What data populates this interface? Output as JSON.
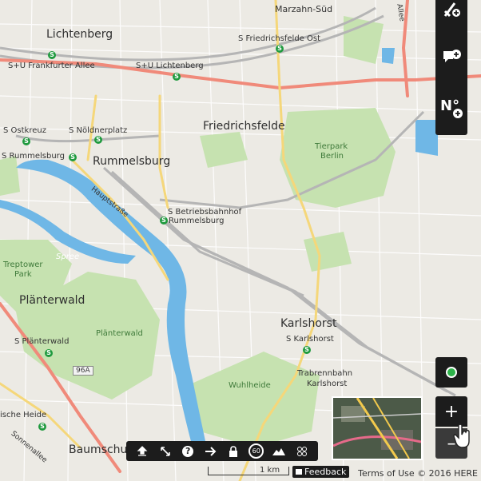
{
  "map": {
    "districts": {
      "lichtenberg": "Lichtenberg",
      "friedrichsfelde": "Friedrichsfelde",
      "rummelsburg": "Rummelsburg",
      "planterwald": "Plänterwald",
      "karlshorst": "Karlshorst",
      "baumschulenweg": "Baumschu",
      "marzahn_sued": "Marzahn-Süd"
    },
    "stations": {
      "frankfurter_allee": "S+U Frankfurter Allee",
      "lichtenberg": "S+U Lichtenberg",
      "friedrichsfelde_ost": "S Friedrichsfelde Ost",
      "ostkreuz": "S Ostkreuz",
      "noeldnerplatz": "S Nöldnerplatz",
      "rummelsburg": "S Rummelsburg",
      "betriebsbahnhof_1": "S Betriebsbahnhof",
      "betriebsbahnhof_2": "Rummelsburg",
      "planterwald": "S Plänterwald",
      "karlshorst": "S Karlshorst",
      "schoeneweide": "ische Heide"
    },
    "parks": {
      "tierpark_1": "Tierpark",
      "tierpark_2": "Berlin",
      "treptower_1": "Treptower",
      "treptower_2": "Park",
      "planterwald_forest": "Plänterwald",
      "wuhlheide": "Wuhlheide",
      "trabrennbahn_1": "Trabrennbahn",
      "trabrennbahn_2": "Karlshorst"
    },
    "water": {
      "spree": "Spree"
    },
    "streets": {
      "hauptstrasse": "Hauptstraße",
      "sonnenallee": "Sonnenallee",
      "allee": "Allee",
      "road_badge": "96A"
    }
  },
  "controls": {
    "top": [
      {
        "name": "add-route-icon"
      },
      {
        "name": "add-comment-icon"
      },
      {
        "name": "add-number-icon",
        "glyph": "N°"
      }
    ],
    "locate_icon": "location-dot-icon",
    "zoom_in": "+",
    "zoom_out": "–",
    "toolbar": [
      {
        "name": "upload-icon",
        "glyph": "⬆"
      },
      {
        "name": "measure-icon",
        "glyph": "⤡"
      },
      {
        "name": "help-icon",
        "glyph": "?"
      },
      {
        "name": "arrow-right-icon",
        "glyph": "→"
      },
      {
        "name": "lock-icon",
        "glyph": "🔒"
      },
      {
        "name": "speed-limit-icon",
        "glyph": "60"
      },
      {
        "name": "terrain-icon",
        "glyph": "⛰"
      },
      {
        "name": "layers-icon",
        "glyph": "88"
      }
    ]
  },
  "footer": {
    "scale": "1 km",
    "feedback": "Feedback",
    "terms": "Terms of Use",
    "copyright": "© 2016 HERE"
  },
  "colors": {
    "major_road": "#f08a7a",
    "secondary_road": "#f5d77a",
    "park": "#c6e2b0",
    "water": "#6fb7e6",
    "rail": "#b0b0b0",
    "station": "#1f9a3e"
  }
}
